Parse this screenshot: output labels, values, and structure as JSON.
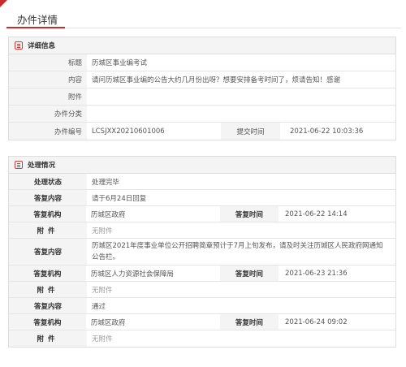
{
  "page_title": "办件详情",
  "details": {
    "section_title": "详细信息",
    "rows": {
      "title": {
        "label": "标题",
        "value": "历城区事业编考试"
      },
      "content": {
        "label": "内容",
        "value": "请问历城区事业编的公告大约几月份出呀？想要安排备考时间了，烦请告知！感谢"
      },
      "attachment": {
        "label": "附件",
        "value": ""
      },
      "category": {
        "label": "办件分类",
        "value": ""
      },
      "number": {
        "label": "办件编号",
        "value": "LCSJXX20210601006",
        "time_label": "提交时间",
        "time_value": "2021-06-22 10:03:36"
      }
    }
  },
  "process": {
    "section_title": "处理情况",
    "status": {
      "label": "处理状态",
      "value": "处理完毕"
    },
    "replies": [
      {
        "content_label": "答复内容",
        "content": "请于6月24日回复",
        "org_label": "答复机构",
        "org": "历城区政府",
        "time_label": "答复时间",
        "time": "2021-06-22 14:14",
        "attach_label": "附件",
        "attach": "无附件"
      },
      {
        "content_label": "答复内容",
        "content": "历城区2021年度事业单位公开招聘简章预计于7月上旬发布，请及时关注历城区人民政府网通知公告栏。",
        "org_label": "答复机构",
        "org": "历城区人力资源社会保障局",
        "time_label": "答复时间",
        "time": "2021-06-23 21:36",
        "attach_label": "附件",
        "attach": "无附件"
      },
      {
        "content_label": "答复内容",
        "content": "通过",
        "org_label": "答复机构",
        "org": "历城区政府",
        "time_label": "答复时间",
        "time": "2021-06-24 09:02",
        "attach_label": "附件",
        "attach": "无附件"
      }
    ]
  },
  "colors": {
    "accent": "#c62d2d",
    "label_bg": "#f4f4f4",
    "border": "#dedede"
  }
}
